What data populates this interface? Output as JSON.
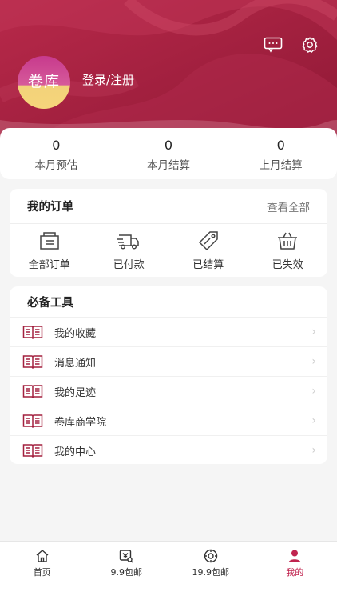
{
  "colors": {
    "brand": "#a3203f",
    "accent": "#c0244f"
  },
  "header": {
    "avatar_text": "卷库",
    "login_label": "登录/注册",
    "message_icon": "message-icon",
    "settings_icon": "gear-icon"
  },
  "stats": [
    {
      "value": "0",
      "label": "本月预估"
    },
    {
      "value": "0",
      "label": "本月结算"
    },
    {
      "value": "0",
      "label": "上月结算"
    }
  ],
  "orders": {
    "title": "我的订单",
    "view_all": "查看全部",
    "items": [
      {
        "label": "全部订单",
        "icon": "wallet-icon"
      },
      {
        "label": "已付款",
        "icon": "truck-icon"
      },
      {
        "label": "已结算",
        "icon": "tag-icon"
      },
      {
        "label": "已失效",
        "icon": "basket-icon"
      }
    ]
  },
  "tools": {
    "title": "必备工具",
    "items": [
      {
        "label": "我的收藏",
        "icon": "book-icon"
      },
      {
        "label": "消息通知",
        "icon": "book-icon"
      },
      {
        "label": "我的足迹",
        "icon": "book-icon"
      },
      {
        "label": "卷库商学院",
        "icon": "book-icon"
      },
      {
        "label": "我的中心",
        "icon": "book-icon"
      }
    ]
  },
  "tabbar": [
    {
      "label": "首页",
      "icon": "home-icon",
      "active": false
    },
    {
      "label": "9.9包邮",
      "icon": "coupon-search-icon",
      "active": false
    },
    {
      "label": "19.9包邮",
      "icon": "gear-circle-icon",
      "active": false
    },
    {
      "label": "我的",
      "icon": "user-icon",
      "active": true
    }
  ]
}
